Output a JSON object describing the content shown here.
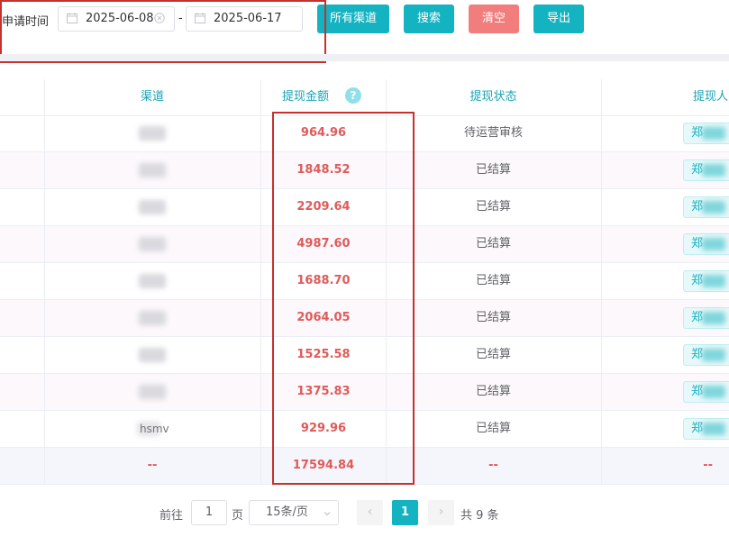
{
  "filter": {
    "label": "申请时间",
    "start_date": "2025-06-08",
    "separator": "-",
    "end_date": "2025-06-17",
    "buttons": {
      "channel": "所有渠道",
      "search": "搜索",
      "clear": "清空",
      "export": "导出"
    }
  },
  "table": {
    "headers": {
      "channel": "渠道",
      "amount": "提现金额",
      "status": "提现状态",
      "person": "提现人"
    },
    "help_glyph": "?",
    "rows": [
      {
        "channel": "",
        "amount": "964.96",
        "status": "待运营审核",
        "person": "郑"
      },
      {
        "channel": "",
        "amount": "1848.52",
        "status": "已结算",
        "person": "郑"
      },
      {
        "channel": "",
        "amount": "2209.64",
        "status": "已结算",
        "person": "郑"
      },
      {
        "channel": "",
        "amount": "4987.60",
        "status": "已结算",
        "person": "郑"
      },
      {
        "channel": "",
        "amount": "1688.70",
        "status": "已结算",
        "person": "郑"
      },
      {
        "channel": "",
        "amount": "2064.05",
        "status": "已结算",
        "person": "郑"
      },
      {
        "channel": "",
        "amount": "1525.58",
        "status": "已结算",
        "person": "郑"
      },
      {
        "channel": "",
        "amount": "1375.83",
        "status": "已结算",
        "person": "郑"
      },
      {
        "channel": "hsmv",
        "amount": "929.96",
        "status": "已结算",
        "person": "郑"
      }
    ],
    "total": {
      "channel": "--",
      "amount": "17594.84",
      "status": "--",
      "person": "--"
    }
  },
  "pagination": {
    "goto_prefix": "前往",
    "goto_value": "1",
    "goto_suffix": "页",
    "page_size": "15条/页",
    "prev": "‹",
    "current": "1",
    "next": "›",
    "total_text": "共 9 条"
  },
  "colors": {
    "accent": "#14b3c2",
    "danger_button": "#f27d7d",
    "amount_text": "#e05a5a",
    "highlight_box": "#c7302c"
  }
}
